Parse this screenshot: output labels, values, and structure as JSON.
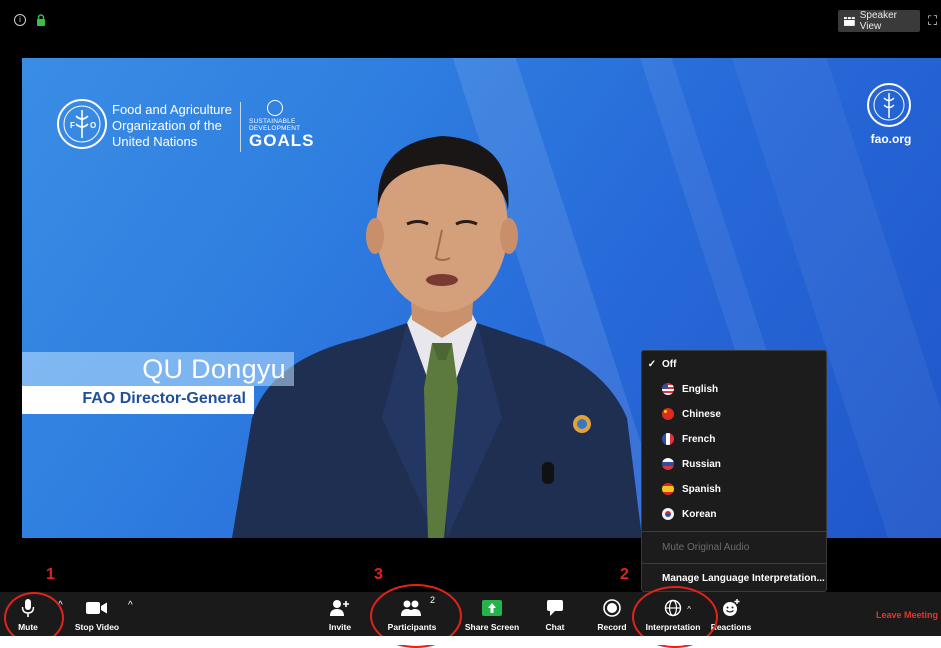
{
  "top_bar": {
    "speaker_view_label": "Speaker View"
  },
  "video": {
    "org_name_lines": [
      "Food and Agriculture",
      "Organization of the",
      "United Nations"
    ],
    "sdg_small": [
      "SUSTAINABLE",
      "DEVELOPMENT"
    ],
    "sdg_big": "GOALS",
    "right_logo_text": "fao.org",
    "speaker_name": "QU Dongyu",
    "speaker_title": "FAO Director-General"
  },
  "interpretation_menu": {
    "selected": "Off",
    "items": [
      "Off",
      "English",
      "Chinese",
      "French",
      "Russian",
      "Spanish",
      "Korean"
    ],
    "mute_original": "Mute Original Audio",
    "manage": "Manage Language Interpretation..."
  },
  "annotations": [
    "1",
    "3",
    "2"
  ],
  "toolbar": {
    "mute": "Mute",
    "stop_video": "Stop Video",
    "invite": "Invite",
    "participants": "Participants",
    "participants_count": "2",
    "share_screen": "Share Screen",
    "chat": "Chat",
    "record": "Record",
    "interpretation": "Interpretation",
    "reactions": "Reactions",
    "leave": "Leave Meeting"
  },
  "colors": {
    "annotation_red": "#e2231a",
    "leave_red": "#e0382f",
    "share_green": "#25b34b",
    "video_blue": "#2769d9"
  }
}
